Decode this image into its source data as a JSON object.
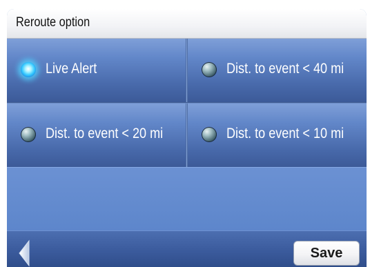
{
  "header": {
    "title": "Reroute option"
  },
  "options": [
    {
      "label": "Live Alert",
      "selected": true
    },
    {
      "label": "Dist. to event < 40 mi",
      "selected": false
    },
    {
      "label": "Dist. to event < 20 mi",
      "selected": false
    },
    {
      "label": "Dist. to event < 10 mi",
      "selected": false
    }
  ],
  "footer": {
    "back_icon": "back-arrow-icon",
    "save_label": "Save"
  },
  "colors": {
    "panel_blue": "#5e86c6",
    "selected_glow": "#34c8ff"
  }
}
